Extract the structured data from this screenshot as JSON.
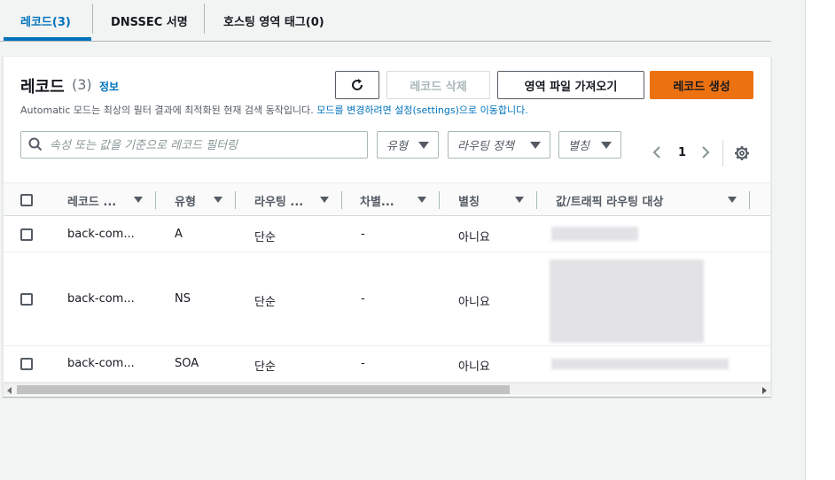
{
  "tabs": [
    {
      "label": "레코드(3)",
      "active": true
    },
    {
      "label": "DNSSEC 서명",
      "active": false
    },
    {
      "label": "호스팅 영역 태그(0)",
      "active": false
    }
  ],
  "header": {
    "title": "레코드",
    "count": "(3)",
    "info_link": "정보",
    "description_prefix": "Automatic 모드는 최상의 필터 결과에 최적화된 현재 검색 동작입니다. ",
    "description_link": "모드를 변경하려면 설정(settings)으로 이동합니다."
  },
  "buttons": {
    "delete": "레코드 삭제",
    "import": "영역 파일 가져오기",
    "create": "레코드 생성"
  },
  "filter": {
    "placeholder": "속성 또는 값을 기준으로 레코드 필터링",
    "type_label": "유형",
    "routing_label": "라우팅 정책",
    "alias_label": "별칭"
  },
  "pagination": {
    "current_page": "1"
  },
  "table": {
    "columns": [
      "레코드 ...",
      "유형",
      "라우팅 ...",
      "차별...",
      "별칭",
      "값/트래픽 라우팅 대상"
    ],
    "rows": [
      {
        "name": "back-com...",
        "type": "A",
        "routing": "단순",
        "diff": "-",
        "alias": "아니요"
      },
      {
        "name": "back-com...",
        "type": "NS",
        "routing": "단순",
        "diff": "-",
        "alias": "아니요"
      },
      {
        "name": "back-com...",
        "type": "SOA",
        "routing": "단순",
        "diff": "-",
        "alias": "아니요"
      }
    ]
  },
  "colors": {
    "accent": "#0073bb",
    "primary_button": "#ec7211"
  }
}
